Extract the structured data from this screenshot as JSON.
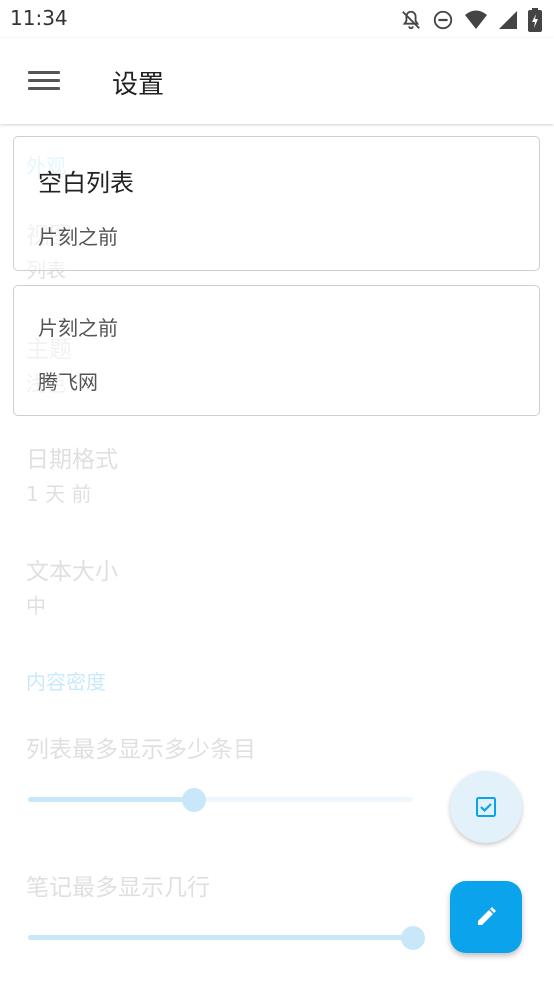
{
  "status_bar": {
    "time": "11:34"
  },
  "app_bar": {
    "title": "设置"
  },
  "settings": {
    "appearance_header": "外观",
    "view": {
      "title": "视图",
      "value": "列表"
    },
    "theme": {
      "title": "主题",
      "value": "浅色"
    },
    "date_format": {
      "title": "日期格式",
      "value": "1 天 前"
    },
    "text_size": {
      "title": "文本大小",
      "value": "中"
    },
    "density_header": "内容密度",
    "max_items": {
      "title": "列表最多显示多少条目",
      "level": 0.43
    },
    "max_lines": {
      "title": "笔记最多显示几行",
      "level": 1.0
    }
  },
  "notes": [
    {
      "title": "空白列表",
      "time": "片刻之前"
    },
    {
      "time": "片刻之前",
      "content": "腾飞网"
    }
  ],
  "colors": {
    "accent": "#0aa3ec",
    "fab_secondary": "#e3f1fb"
  }
}
